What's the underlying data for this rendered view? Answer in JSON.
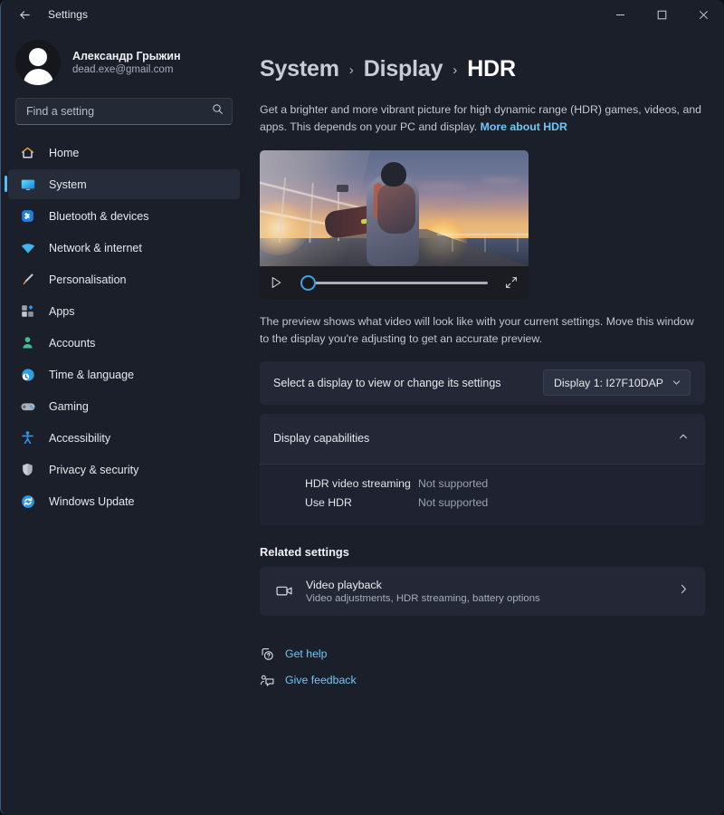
{
  "window": {
    "title": "Settings",
    "back_icon": "back-arrow-icon",
    "minimize_label": "Minimise",
    "maximize_label": "Maximise",
    "close_label": "Close"
  },
  "account": {
    "name": "Александр Грыжин",
    "email": "dead.exe@gmail.com",
    "avatar_icon": "person-avatar-icon"
  },
  "search": {
    "placeholder": "Find a setting",
    "value": "",
    "icon": "search-icon"
  },
  "sidebar": {
    "items": [
      {
        "label": "Home",
        "icon": "home-icon",
        "selected": false
      },
      {
        "label": "System",
        "icon": "monitor-icon",
        "selected": true
      },
      {
        "label": "Bluetooth & devices",
        "icon": "bluetooth-icon",
        "selected": false
      },
      {
        "label": "Network & internet",
        "icon": "wifi-icon",
        "selected": false
      },
      {
        "label": "Personalisation",
        "icon": "paintbrush-icon",
        "selected": false
      },
      {
        "label": "Apps",
        "icon": "apps-grid-icon",
        "selected": false
      },
      {
        "label": "Accounts",
        "icon": "account-person-icon",
        "selected": false
      },
      {
        "label": "Time & language",
        "icon": "clock-globe-icon",
        "selected": false
      },
      {
        "label": "Gaming",
        "icon": "gamepad-icon",
        "selected": false
      },
      {
        "label": "Accessibility",
        "icon": "accessibility-person-icon",
        "selected": false
      },
      {
        "label": "Privacy & security",
        "icon": "shield-icon",
        "selected": false
      },
      {
        "label": "Windows Update",
        "icon": "update-refresh-icon",
        "selected": false
      }
    ]
  },
  "breadcrumb": {
    "root": "System",
    "mid": "Display",
    "current": "HDR",
    "separator": "›"
  },
  "intro": {
    "text": "Get a brighter and more vibrant picture for high dynamic range (HDR) games, videos, and apps. This depends on your PC and display. ",
    "link": "More about HDR"
  },
  "video": {
    "play_icon": "play-triangle-icon",
    "fullscreen_icon": "fullscreen-expand-icon",
    "seek_position_percent": 0,
    "preview_note": "The preview shows what video will look like with your current settings. Move this window to the display you're adjusting to get an accurate preview."
  },
  "display_selector": {
    "label": "Select a display to view or change its settings",
    "selected": "Display 1: I27F10DAP",
    "chevron_icon": "chevron-down-icon"
  },
  "capabilities": {
    "title": "Display capabilities",
    "expanded": true,
    "chevron_icon": "chevron-up-icon",
    "rows": [
      {
        "name": "HDR video streaming",
        "value": "Not supported"
      },
      {
        "name": "Use HDR",
        "value": "Not supported"
      }
    ]
  },
  "related": {
    "title": "Related settings",
    "item": {
      "icon": "video-camera-icon",
      "title": "Video playback",
      "subtitle": "Video adjustments, HDR streaming, battery options",
      "chevron_icon": "chevron-right-icon"
    }
  },
  "footer": {
    "links": [
      {
        "label": "Get help",
        "icon": "help-question-icon"
      },
      {
        "label": "Give feedback",
        "icon": "feedback-icon"
      }
    ]
  },
  "colors": {
    "accent": "#4cc2ff",
    "link": "#6fc7f5",
    "window_bg": "#1b1f2a",
    "card_bg": "#232736",
    "selected_nav": "#272c3a"
  }
}
